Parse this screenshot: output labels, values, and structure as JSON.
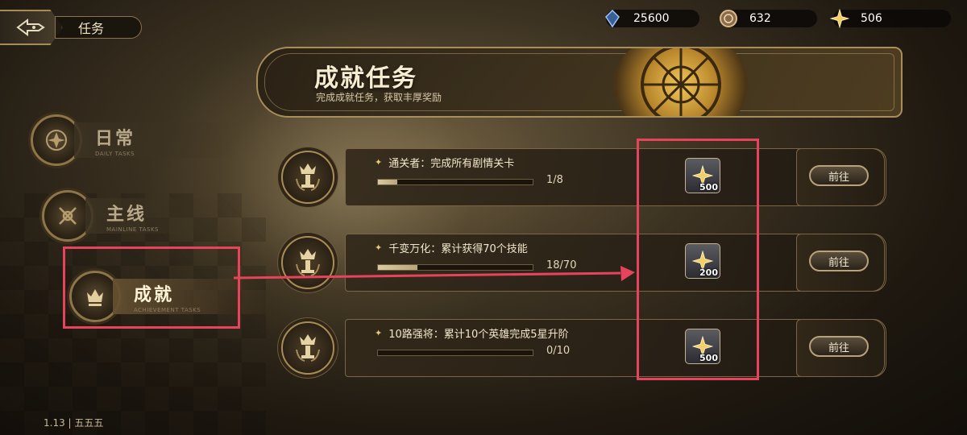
{
  "header": {
    "title": "任务",
    "currencies": [
      {
        "icon": "blue-crystal-icon",
        "value": "25600"
      },
      {
        "icon": "bronze-coin-icon",
        "value": "632"
      },
      {
        "icon": "gold-star-icon",
        "value": "506"
      }
    ]
  },
  "banner": {
    "title": "成就任务",
    "subtitle": "完成成就任务，获取丰厚奖励"
  },
  "sidebar": {
    "items": [
      {
        "label": "日常",
        "sub": "DAILY TASKS",
        "active": false
      },
      {
        "label": "主线",
        "sub": "MAINLINE TASKS",
        "active": false
      },
      {
        "label": "成就",
        "sub": "ACHIEVEMENT TASKS",
        "active": true
      }
    ]
  },
  "tasks": [
    {
      "title": "通关者：完成所有剧情关卡",
      "progress_text": "1/8",
      "progress": 0.125,
      "reward": "500",
      "button": "前往"
    },
    {
      "title": "千变万化：累计获得70个技能",
      "progress_text": "18/70",
      "progress": 0.257,
      "reward": "200",
      "button": "前往"
    },
    {
      "title": "10路强将：累计10个英雄完成5星升阶",
      "progress_text": "0/10",
      "progress": 0.0,
      "reward": "500",
      "button": "前往"
    }
  ],
  "footer": {
    "version": "1.13 | 五五五"
  },
  "colors": {
    "accent_gold": "#a98d5a",
    "annotation_red": "#e8435c"
  }
}
